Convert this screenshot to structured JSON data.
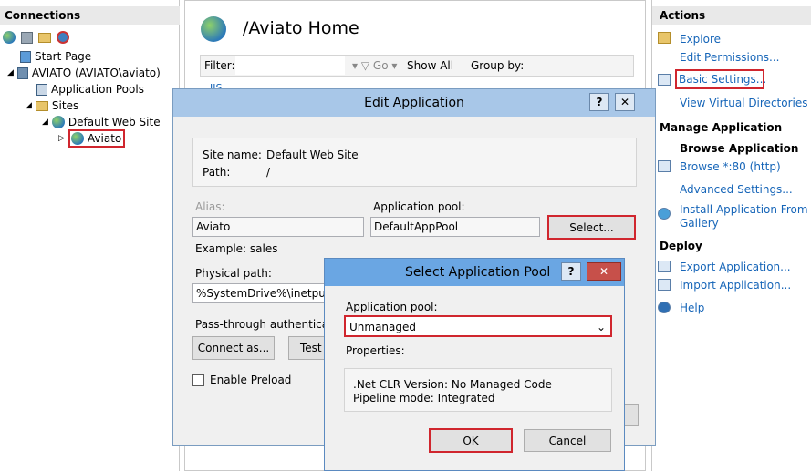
{
  "connections": {
    "title": "Connections",
    "tree": [
      {
        "label": "Start Page"
      },
      {
        "label": "AVIATO (AVIATO\\aviato)"
      },
      {
        "label": "Application Pools"
      },
      {
        "label": "Sites"
      },
      {
        "label": "Default Web Site"
      },
      {
        "label": "Aviato"
      }
    ]
  },
  "center": {
    "title": "/Aviato Home",
    "filter_label": "Filter:",
    "go_label": "Go",
    "show_all_label": "Show All",
    "group_by_label": "Group by:",
    "iis_label": "IIS"
  },
  "actions": {
    "title": "Actions",
    "explore": "Explore",
    "edit_permissions": "Edit Permissions...",
    "basic_settings": "Basic Settings...",
    "view_virtual_dirs": "View Virtual Directories",
    "manage_app": "Manage Application",
    "browse_app": "Browse Application",
    "browse_80": "Browse *:80 (http)",
    "advanced_settings": "Advanced Settings...",
    "install_gallery_line1": "Install Application From",
    "install_gallery_line2": "Gallery",
    "deploy": "Deploy",
    "export_app": "Export Application...",
    "import_app": "Import Application...",
    "help": "Help"
  },
  "edit_app": {
    "title": "Edit Application",
    "help_btn": "?",
    "close_btn": "✕",
    "site_name_label": "Site name:",
    "site_name_value": "Default Web Site",
    "path_label": "Path:",
    "path_value": "/",
    "alias_label": "Alias:",
    "alias_value": "Aviato",
    "alias_example": "Example: sales",
    "app_pool_label": "Application pool:",
    "app_pool_value": "DefaultAppPool",
    "select_btn": "Select...",
    "physical_path_label": "Physical path:",
    "physical_path_value": "%SystemDrive%\\inetpub\\w",
    "passthrough_label": "Pass-through authenticati",
    "connect_as_btn": "Connect as...",
    "test_btn": "Test",
    "enable_preload": "Enable Preload"
  },
  "select_pool": {
    "title": "Select Application Pool",
    "help_btn": "?",
    "close_btn": "✕",
    "app_pool_label": "Application pool:",
    "app_pool_value": "Unmanaged",
    "properties_label": "Properties:",
    "clr_version": ".Net CLR Version: No Managed Code",
    "pipeline_mode": "Pipeline mode: Integrated",
    "ok_btn": "OK",
    "cancel_btn": "Cancel"
  },
  "colors": {
    "highlight_red": "#d0262e",
    "link_blue": "#1665b8",
    "title_blue": "#a8c7e8",
    "close_red": "#c7504a"
  }
}
